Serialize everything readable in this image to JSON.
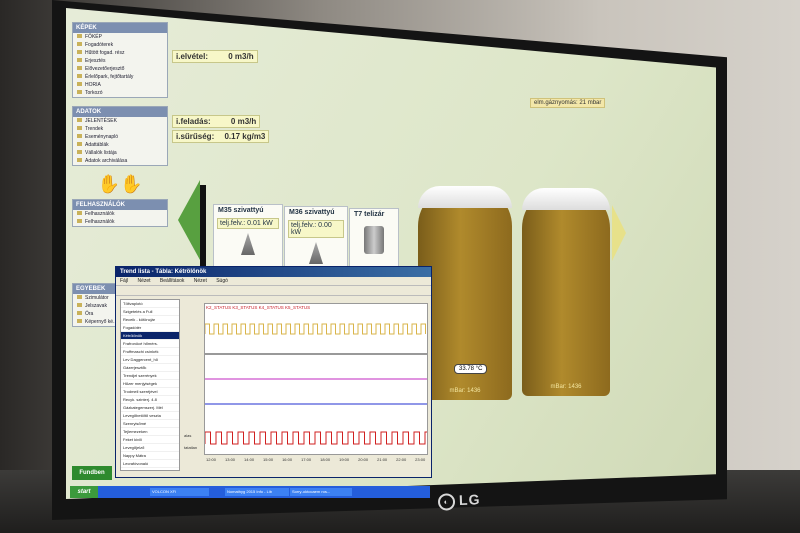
{
  "nav": {
    "kepek": {
      "title": "KÉPEK",
      "items": [
        "FŐKÉP",
        "Fogadóterek",
        "Hűtött fogad. rész",
        "Erjesztés",
        "Elővezetőerjesztő",
        "Érlelőpark, fejtőtartály",
        "HORIA",
        "Torkozó"
      ]
    },
    "adatok": {
      "title": "ADATOK",
      "items": [
        "JELENTÉSEK",
        "Trendek",
        "Eseménynapló",
        "Adattáblák",
        "Vállalók listája",
        "Adatok archiválása"
      ]
    },
    "felhasznalok": {
      "title": "FELHASZNÁLÓK",
      "items": [
        "Felhasználók",
        "Felhasználók"
      ]
    },
    "egyebek": {
      "title": "EGYEBEK",
      "items": [
        "Szimulátor",
        "Jelszavak",
        "Óra",
        "Képernyő ké..."
      ]
    },
    "brand": "Fundben"
  },
  "readouts": {
    "elvetel": "i.elvétel:",
    "elvetel_val": "0 m3/h",
    "felad": "i.feladás:",
    "felad_val": "0 m3/h",
    "suruseg": "i.sűrűség:",
    "suruseg_val": "0.17 kg/m3",
    "gaznyomas": "elm.gáznyomás: 21 mbar"
  },
  "pumps": [
    {
      "name": "M35 szivattyú",
      "label": "telj.felv.:",
      "value": "0.01 kW"
    },
    {
      "name": "M36 szivattyú",
      "label": "telj.felv.:",
      "value": "0.00 kW"
    },
    {
      "name": "T7 telizár"
    }
  ],
  "tanks": [
    {
      "temp": "33.78 °C",
      "level": "mBar: 1436"
    },
    {
      "level": "mBar: 1436"
    }
  ],
  "trend": {
    "title": "Trend lista - Tábla: Kétrölönök",
    "menu": [
      "Fájl",
      "Nézet",
      "Beállítások",
      "Nézet",
      "Súgó"
    ],
    "legend": "K2_STATUS  K3_STATUS  K4_STATUS  K5_STATUS",
    "side_items": [
      "Töltvaplotó",
      "Szigetelés a Full",
      "Receik - kötöncjár",
      "Fogadótér",
      "Kétrölönök",
      "Frafronöcé hőmérs.",
      "Fruffmaschi csínkék",
      "Lev Daggercent_hõ",
      "Gázerjesztők",
      "Trendjel szerények",
      "Hűzer menjyiségek",
      "Trodmell szeréjével",
      "Recyk. szinterj. 4.8",
      "Gázkategemszerj. Mél",
      "Levegőbetöltő veszta",
      "Szenryisőmé",
      "Tejlemezeken",
      "Feket kivili",
      "Levegőjelző",
      "Nappy Mátra",
      "Lecrafóvonaló"
    ],
    "times": [
      "12:00",
      "13:00",
      "14:00",
      "15:00",
      "16:00",
      "17:00",
      "18:00",
      "19:00",
      "20:00",
      "21:00",
      "22:00",
      "23:00"
    ],
    "ylabels": [
      "alas",
      "tatatlan"
    ],
    "colors": [
      "#c8202a",
      "#d9b44a",
      "#c02ac0",
      "#202fd0",
      "#d02020"
    ]
  },
  "taskbar": {
    "start": "start",
    "tasks": [
      "VOLCON XFI",
      "Nomathyg 2015 Info - Lib",
      "Sorry-oktocaem ros..."
    ]
  },
  "logo": "LG"
}
